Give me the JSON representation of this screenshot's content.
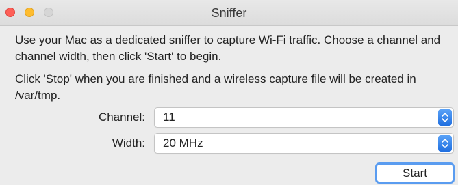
{
  "window": {
    "title": "Sniffer"
  },
  "content": {
    "paragraph1": "Use your Mac as a dedicated sniffer to capture Wi-Fi traffic. Choose a channel and channel width, then click 'Start' to begin.",
    "paragraph2": "Click 'Stop' when you are finished and a wireless capture file will be created in /var/tmp."
  },
  "form": {
    "channel_label": "Channel:",
    "channel_value": "11",
    "width_label": "Width:",
    "width_value": "20 MHz"
  },
  "buttons": {
    "start_label": "Start"
  },
  "colors": {
    "close": "#fe5f57",
    "minimize": "#febc2e",
    "zoom_inactive": "#d6d6d6",
    "accent": "#1f6fe0"
  },
  "icons": {
    "popup_arrows": "up-down-chevron-icon"
  }
}
